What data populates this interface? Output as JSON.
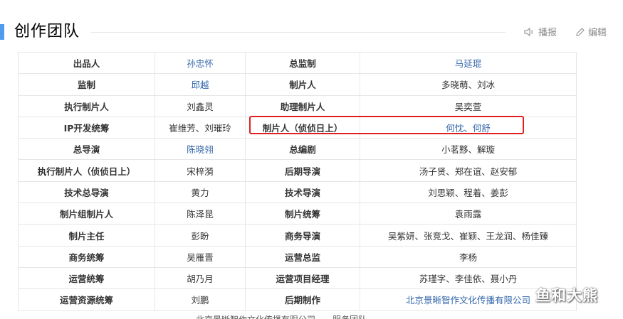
{
  "section": {
    "title": "创作团队",
    "report_label": "播报",
    "edit_label": "编辑"
  },
  "rows": [
    [
      {
        "t": "出品人"
      },
      {
        "t": "孙忠怀",
        "link": true
      },
      {
        "t": "总监制"
      },
      {
        "t": "马延琨",
        "link": true
      }
    ],
    [
      {
        "t": "监制"
      },
      {
        "t": "邱越",
        "link": true
      },
      {
        "t": "制片人"
      },
      {
        "t": "多晓萌、刘冰"
      }
    ],
    [
      {
        "t": "执行制片人"
      },
      {
        "t": "刘鑫灵"
      },
      {
        "t": "助理制片人"
      },
      {
        "t": "吴奕萱"
      }
    ],
    [
      {
        "t": "IP开发统筹"
      },
      {
        "t": "崔维芳、刘璀玲"
      },
      {
        "t": "制片人（侦侦日上）"
      },
      {
        "t": "何忱、何舒",
        "link": true
      }
    ],
    [
      {
        "t": "总导演"
      },
      {
        "t": "陈晓翎",
        "link": true
      },
      {
        "t": "总编剧"
      },
      {
        "t": "小茗黟、解璇"
      }
    ],
    [
      {
        "t": "执行制片人（侦侦日上）"
      },
      {
        "t": "宋梓漪"
      },
      {
        "t": "后期导演"
      },
      {
        "t": "汤子贤、郑在谊、赵安郁"
      }
    ],
    [
      {
        "t": "技术总导演"
      },
      {
        "t": "黄力"
      },
      {
        "t": "技术导演"
      },
      {
        "t": "刘思颖、程着、姜彭"
      }
    ],
    [
      {
        "t": "制片组制片人"
      },
      {
        "t": "陈泽昆"
      },
      {
        "t": "制片统筹"
      },
      {
        "t": "袁雨露"
      }
    ],
    [
      {
        "t": "制片主任"
      },
      {
        "t": "彭盼"
      },
      {
        "t": "商务导演"
      },
      {
        "t": "吴紫妍、张竞戈、崔颖、王龙润、杨佳臻"
      }
    ],
    [
      {
        "t": "商务统筹"
      },
      {
        "t": "吴雁晋"
      },
      {
        "t": "运营总监"
      },
      {
        "t": "李杨"
      }
    ],
    [
      {
        "t": "运营统筹"
      },
      {
        "t": "胡乃月"
      },
      {
        "t": "运营项目经理"
      },
      {
        "t": "苏瑾字、李佳依、聂小丹"
      }
    ],
    [
      {
        "t": "运营资源统筹"
      },
      {
        "t": "刘鹏"
      },
      {
        "t": "后期制作"
      },
      {
        "t": "北京景晰智作文化传播有限公司",
        "link": true
      }
    ]
  ],
  "watermark": "鱼和大熊",
  "cut_row_text": "北京景晰智作文化传播有限公司……服务团队"
}
